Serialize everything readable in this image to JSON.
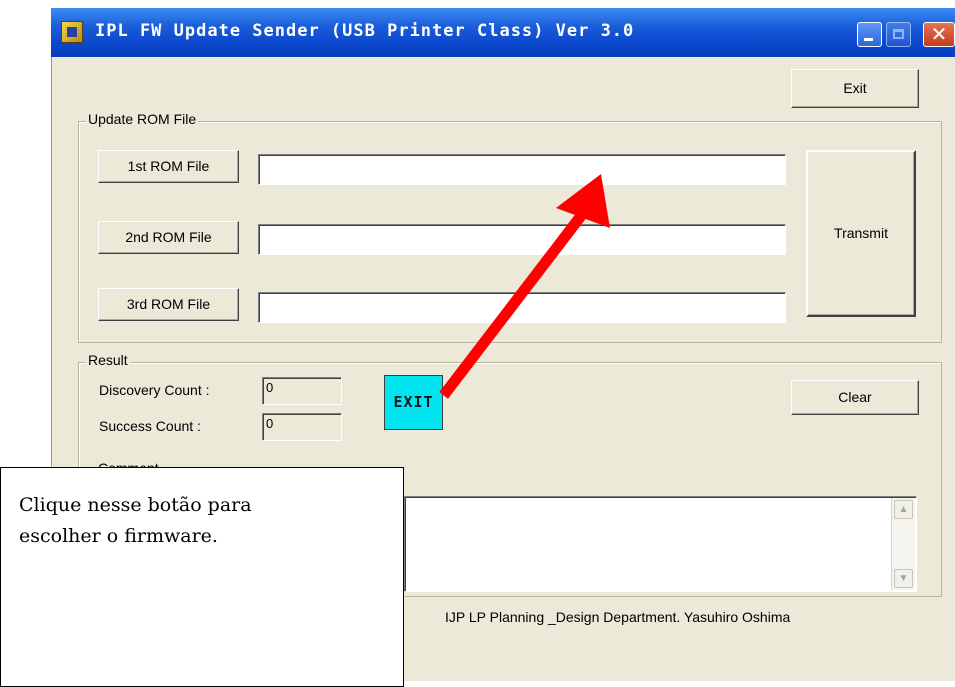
{
  "window": {
    "title": "IPL FW Update Sender (USB Printer Class)  Ver 3.0",
    "icons": [
      "app-icon",
      "minimize-icon",
      "maximize-icon",
      "close-icon"
    ],
    "close_glyph": "✕"
  },
  "toolbar": {
    "exit_label": "Exit"
  },
  "update_rom": {
    "group_label": "Update ROM File",
    "buttons": [
      {
        "label": "1st ROM File",
        "path": ""
      },
      {
        "label": "2nd ROM File",
        "path": ""
      },
      {
        "label": "3rd ROM File",
        "path": ""
      }
    ],
    "transmit_label": "Transmit"
  },
  "result": {
    "group_label": "Result",
    "discovery_label": "Discovery Count :",
    "discovery_value": "0",
    "success_label": "Success Count :",
    "success_value": "0",
    "clear_label": "Clear",
    "exit_badge_label": "EXIT",
    "comment_label": "Comment"
  },
  "footer": {
    "credit": "IJP LP Planning _Design Department.  Yasuhiro Oshima"
  },
  "callout": {
    "text": "Clique nesse botão para\nescolher o firmware."
  },
  "colors": {
    "titlebar": "#0b48cf",
    "window_bg": "#ece9d8",
    "exit_badge": "#00e5f0",
    "arrow": "#ff0000"
  }
}
